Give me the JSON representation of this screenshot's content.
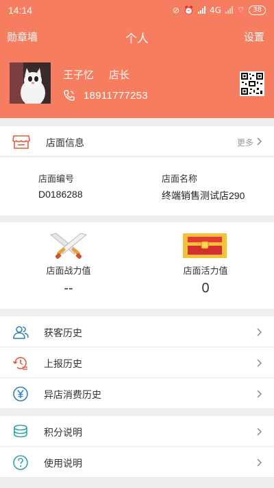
{
  "status_bar": {
    "time": "14:14",
    "network": "4G",
    "battery": "38"
  },
  "nav": {
    "left": "勋章墙",
    "title": "个人",
    "right": "设置"
  },
  "profile": {
    "name": "王子忆",
    "role": "店长",
    "phone": "18911777253"
  },
  "store": {
    "title": "店面信息",
    "more": "更多",
    "id_label": "店面编号",
    "id_value": "D0186288",
    "name_label": "店面名称",
    "name_value": "终端销售测试店290"
  },
  "stats": {
    "power_label": "店面战力值",
    "power_value": "--",
    "vitality_label": "店面活力值",
    "vitality_value": "0"
  },
  "menu": [
    {
      "label": "获客历史",
      "icon": "users-icon"
    },
    {
      "label": "上报历史",
      "icon": "history-icon"
    },
    {
      "label": "异店消费历史",
      "icon": "yuan-icon"
    },
    {
      "label": "积分说明",
      "icon": "coins-icon"
    },
    {
      "label": "使用说明",
      "icon": "help-icon"
    }
  ],
  "colors": {
    "header": "#f77d61",
    "accent_red": "#e45a3a",
    "icon_blue": "#2b7fc4"
  }
}
